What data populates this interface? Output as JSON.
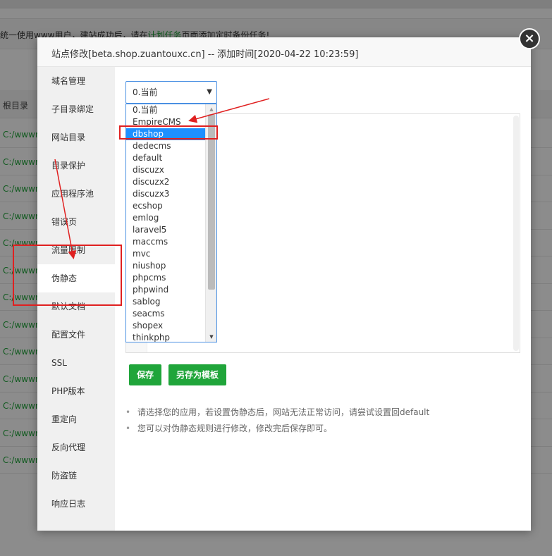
{
  "background": {
    "notice": "统一使用www用户，建站成功后，请在",
    "notice_link": "计划任务",
    "notice_tail": "页面添加定时备份任务!",
    "column_header": "根目录",
    "rows": [
      "C:/wwwr",
      "C:/wwwr",
      "C:/wwwr",
      "C:/wwwr",
      "C:/wwwr",
      "C:/wwwr",
      "C:/wwwr",
      "C:/wwwr",
      "C:/wwwr",
      "C:/wwwr",
      "C:/wwwr",
      "C:/wwwr",
      "C:/wwwr"
    ]
  },
  "modal": {
    "title": "站点修改[beta.shop.zuantouxc.cn] -- 添加时间[2020-04-22 10:23:59]",
    "close_glyph": "×"
  },
  "sidebar": {
    "items": [
      {
        "label": "域名管理"
      },
      {
        "label": "子目录绑定"
      },
      {
        "label": "网站目录"
      },
      {
        "label": "目录保护"
      },
      {
        "label": "应用程序池"
      },
      {
        "label": "错误页"
      },
      {
        "label": "流量限制"
      },
      {
        "label": "伪静态"
      },
      {
        "label": "默认文档"
      },
      {
        "label": "配置文件"
      },
      {
        "label": "SSL"
      },
      {
        "label": "PHP版本"
      },
      {
        "label": "重定向"
      },
      {
        "label": "反向代理"
      },
      {
        "label": "防盗链"
      },
      {
        "label": "响应日志"
      }
    ],
    "active": "伪静态"
  },
  "rewrite": {
    "select_value": "0.当前",
    "caret": "▼",
    "options": [
      "0.当前",
      "EmpireCMS",
      "dbshop",
      "dedecms",
      "default",
      "discuzx",
      "discuzx2",
      "discuzx3",
      "ecshop",
      "emlog",
      "laravel5",
      "maccms",
      "mvc",
      "niushop",
      "phpcms",
      "phpwind",
      "sablog",
      "seacms",
      "shopex",
      "thinkphp"
    ],
    "highlighted": "dbshop",
    "scroll_up": "▲",
    "scroll_down": "▼",
    "save_label": "保存",
    "save_as_template_label": "另存为模板",
    "tips": [
      "请选择您的应用，若设置伪静态后，网站无法正常访问，请尝试设置回default",
      "您可以对伪静态规则进行修改，修改完后保存即可。"
    ]
  },
  "colors": {
    "accent_green": "#20a53a",
    "select_border": "#4a90e2",
    "selected_option": "#1e90ff",
    "annotation_red": "#e02020"
  }
}
